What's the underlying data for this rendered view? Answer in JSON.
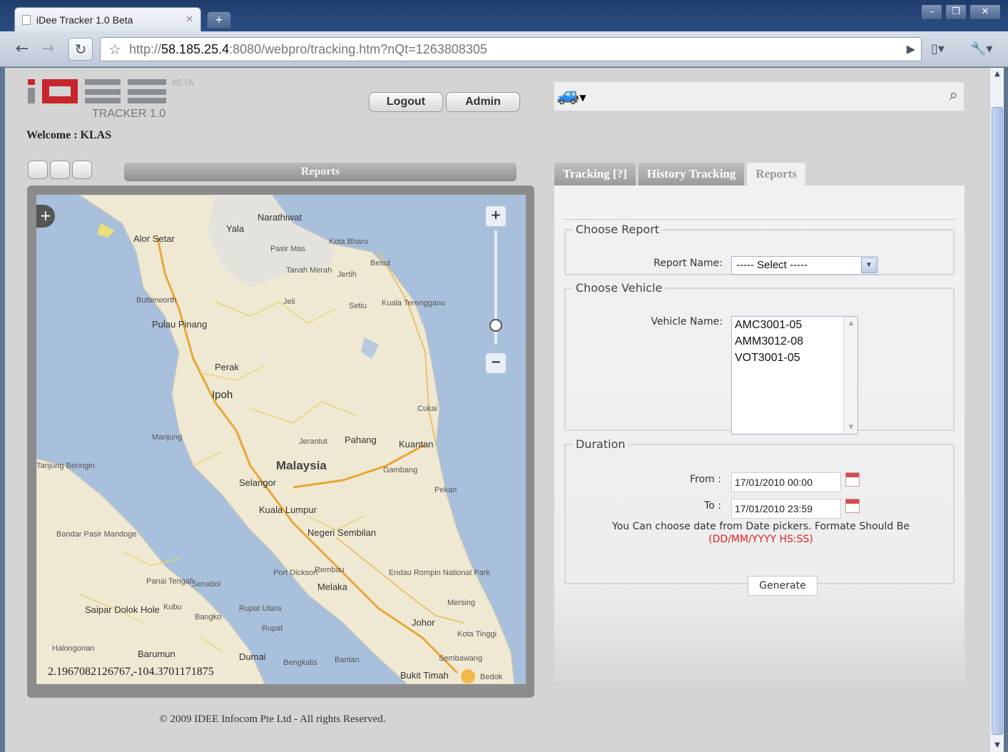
{
  "browser": {
    "tab_title": "iDee Tracker 1.0 Beta",
    "url_scheme": "http://",
    "url_host": "58.185.25.4",
    "url_rest": ":8080/webpro/tracking.htm?nQt=1263808305"
  },
  "header": {
    "beta": "BETA",
    "tracker_version": "TRACKER 1.0",
    "welcome": "Welcome : KLAS",
    "logout_label": "Logout",
    "admin_label": "Admin"
  },
  "left": {
    "reports_bar": "Reports",
    "coordinates": "2.1967082126767,-104.3701171875",
    "map_labels": [
      "Narathiwat",
      "Yala",
      "Alor Setar",
      "Pasir Mas",
      "Kota Bharu",
      "Besut",
      "Tanah Merah",
      "Jertih",
      "Butterworth",
      "Jeli",
      "Setiu",
      "Kuala Terengganu",
      "Pulau Pinang",
      "Perak",
      "Ipoh",
      "Cukai",
      "Manjung",
      "Jerantut",
      "Pahang",
      "Kuantan",
      "Malaysia",
      "Gambang",
      "Selangor",
      "Pekan",
      "Kuala Lumpur",
      "Negeri Sembilan",
      "Port Dickson",
      "Rembau",
      "Melaka",
      "Endau Rompin National Park",
      "Mersing",
      "Johor",
      "Kota Tinggi",
      "Dumai",
      "Bengkalis",
      "Bantan",
      "Bukit Timah",
      "Bedok",
      "Sembawang",
      "Barumun",
      "Saipar Dolok Hole",
      "Bandar Pasir Mandoge",
      "Tanjung Beringin",
      "Rupat Utara",
      "Rupat",
      "Senaboi",
      "Bangko",
      "Kubu",
      "Panai Tengah",
      "Halongonan"
    ]
  },
  "tabs": [
    "Tracking [?]",
    "History Tracking",
    "Reports"
  ],
  "report_form": {
    "choose_report_legend": "Choose Report",
    "report_name_label": "Report Name:",
    "report_select_value": "----- Select -----",
    "choose_vehicle_legend": "Choose Vehicle",
    "vehicle_name_label": "Vehicle Name:",
    "vehicles": [
      "AMC3001-05",
      "AMM3012-08",
      "VOT3001-05"
    ],
    "duration_legend": "Duration",
    "from_label": "From :",
    "from_value": "17/01/2010 00:00",
    "to_label": "To :",
    "to_value": "17/01/2010 23:59",
    "hint": "You Can choose date from Date pickers. Formate Should Be",
    "format": "(DD/MM/YYYY HS:SS)",
    "generate_label": "Generate"
  },
  "footer": "© 2009 IDEE Infocom Pte Ltd - All rights Reserved.",
  "colors": {
    "accent_red": "#c8262d",
    "map_water": "#a9c0dc",
    "map_land": "#efe9d4"
  }
}
